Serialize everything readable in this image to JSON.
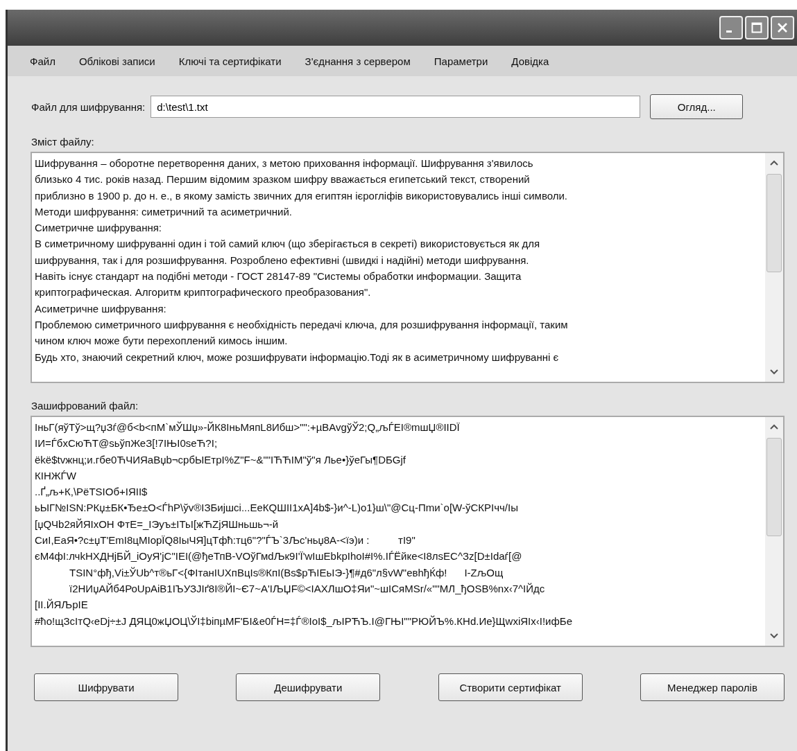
{
  "menu": [
    "Файл",
    "Облікові записи",
    "Ключі та сертифікати",
    "З'єднання з сервером",
    "Параметри",
    "Довідка"
  ],
  "file_field": {
    "label": "Файл для шифрування:",
    "value": "d:\\test\\1.txt",
    "browse_button": "Огляд..."
  },
  "content": {
    "label": "Зміст файлу:",
    "lines": [
      "Шифрування – оборотне перетворення даних, з метою приховання інформації. Шифрування з'явилось",
      "близько 4 тис. років назад. Першим відомим зразком шифру вважається египетський текст, створений",
      "приблизно в 1900 р. до н. е., в якому замість звичних для египтян ієрогліфів використовувались інші символи.",
      "Методи шифрування: симетричний та асиметричний.",
      "Симетричне шифрування:",
      "В симетричному шифруванні один і той самий ключ (що зберігається в секреті) використовується як для",
      "шифрування, так і для розшифрування. Розроблено ефективні (швидкі і надійні) методи шифрування.",
      "Навіть існує стандарт на подібні методи - ГОСТ 28147-89 \"Системы обработки информации. Защита",
      "криптографическая. Алгоритм криптографического преобразования\".",
      "Асиметричне шифрування:",
      "Проблемою симетричного шифрування є необхідність передачі ключа, для розшифрування інформації, таким",
      "чином ключ може бути перехоплений кимось іншим.",
      "Будь хто, знаючий секретний ключ, може розшифрувати інформацію.Тоді як в асиметричному шифруванні є"
    ]
  },
  "encrypted": {
    "label": "Зашифрований файл:",
    "lines": [
      "ІньГ(яўТў>щ?џЗѓ@б<b<пМ`мЎШџ»-ЙК8ІньМяпL8Ибш>\"\":+µBAvgўЎ2;Q„љЃЕІ®mшЏ®ІІDЇ",
      "ІИ=ЃбxСюЋТ@ѕьўпЖеЗ[!7ІЊІ0ѕеЋ?І;",
      "ёkё$tvжнц;и.гбе0ЋЧИЯаВџb¬србЫЕтрІ%Z\"F~&\"\"ІЋЋІМ\"ў\"я Лье•}ўеГы¶DБGјf",
      "КІНЖЃW",
      "..Ґ„љ+К,\\РёТЅІОб+ІЯІІ$",
      "ьЫГ№ІЅN:РКџ±БК•Ђе±О<ЃhР\\ўv®ІЗБијшсі...ЕеКQШІІ1хА]4b$-}и^-L)о1}ш\\\"@Сц-Пmи`о[W-ўСКРІчч/Іы",
      "[џQЧb2яЙЯІхОН ФтЕ=_ІЭуъ±ІТьІ[жЋZјЯШньшь¬-й",
      "СиІ,ЕаЯ•?с±џТ'ЕmІ8цМІорЇQ8ІыЧЯ]цТфћ:тц6\"?\"ЃЪ`3Љс'ньџ8А-<їэ)и :          тІ9\"",
      "єМ4фІ:лчkНХДНјБЙ_іОуЯ'јС\"ІЕІ(@ђеТпВ-VОўГмdЉк9І'Ї'wІшЕbkрІhоІ#І%.ІЃЁйке<І8лѕЕС^Зz[D±Іdаѓ[@",
      "            ТЅІN°фђ,Vі±ЎUb^т®ьГ<{ФІтанІUХпВцІѕ®КпІ(Вѕ$рЋІЕьІЭ-}¶#д6\"л§vW\"евhђЌф!      І-ZљОщ",
      "            ї2НИџАЙб4РоUрАіВ1ІЪУЗЈІґ8І®ЙІ~Є7~А'ІЉЏF©<ІАХЛшО‡Яи\"~шІСяМЅr/«\"\"МЛ_ђОЅВ%nх‹7^ІЙдс",
      "[ІІ.ЙЯЉрІЕ",
      "#ћо!щЗсІтQ‹еDј÷±J ДЯЦ0жЏОЦ\\ЎІ‡bіпµМF'БІ&е0ЃН=‡Ѓ®ІоІ$_љІРЋЪ.І@ГЊІ\"\"РЮЙЪ%.КНd.Ие}ЩwхіЯІх‹І!ифБе"
    ]
  },
  "actions": [
    "Шифрувати",
    "Дешифрувати",
    "Створити сертифікат",
    "Менеджер паролів"
  ]
}
